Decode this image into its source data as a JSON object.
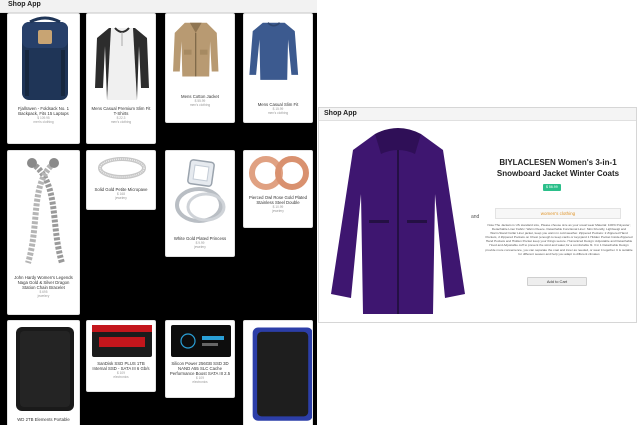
{
  "left_window": {
    "app_title": "Shop App",
    "products": [
      {
        "name": "Fjallraven - Foldsack No. 1 Backpack, Fits 15 Laptops",
        "price": "$ 109.95",
        "category": "men's clothing",
        "icon": "backpack"
      },
      {
        "name": "Mens Casual Premium Slim Fit T-Shirts",
        "price": "$ 22.3",
        "category": "men's clothing",
        "icon": "raglan-shirt"
      },
      {
        "name": "Mens Cotton Jacket",
        "price": "$ 55.99",
        "category": "men's clothing",
        "icon": "cotton-jacket"
      },
      {
        "name": "Mens Casual Slim Fit",
        "price": "$ 15.99",
        "category": "men's clothing",
        "icon": "long-sleeve-shirt"
      },
      {
        "name": "John Hardy Women's Legends Naga Gold & Silver Dragon Station Chain Bracelet",
        "price": "$ 695",
        "category": "jewelery",
        "icon": "chain-bracelet"
      },
      {
        "name": "Solid Gold Petite Micropave",
        "price": "$ 168",
        "category": "jewelery",
        "icon": "silver-ring"
      },
      {
        "name": "White Gold Plated Princess",
        "price": "$ 9.99",
        "category": "jewelery",
        "icon": "diamond-ring"
      },
      {
        "name": "Pierced Owl Rose Gold Plated Stainless Steel Double",
        "price": "$ 10.99",
        "category": "jewelery",
        "icon": "rose-gold-plugs"
      },
      {
        "name": "WD 2TB Elements Portable",
        "price": "",
        "category": "",
        "icon": "black-hard-drive"
      },
      {
        "name": "SanDisk SSD PLUS 1TB Internal SSD - SATA III 6 Gb/s",
        "price": "$ 109",
        "category": "electronics",
        "icon": "sandisk-ssd"
      },
      {
        "name": "Silicon Power 256GB SSD 3D NAND A55 SLC Cache Performance Boost SATA III 2.5",
        "price": "$ 109",
        "category": "electronics",
        "icon": "silicon-power-ssd"
      },
      {
        "name": "",
        "price": "",
        "category": "",
        "icon": "blue-hard-drive"
      }
    ]
  },
  "right_window": {
    "app_title": "Shop App",
    "and_tag": "and",
    "product": {
      "title": "BIYLACLESEN Women's 3-in-1 Snowboard Jacket Winter Coats",
      "price": "$ 56.99",
      "category": "women's clothing",
      "description": "Note:The Jackets is US standard size, Please choose size as your usual wear Material: 100% Polyester; Detachable Liner Fabric: Warm Fleece. Detachable Functional Liner: Skin Friendly, Lightweigt and Warm.Stand Collar Liner jacket, keep you warm in cold weather. Zippered Pockets: 2 Zippered Hand Pockets, 2 Zippered Pockets on Chest (enough to keep cards or keys)and 1 Hidden Pocket Inside.Zippered Hand Pockets and Hidden Pocket keep your things secure. Humanized Design: Adjustable and Detachable Hood and Adjustable cuff to prevent the wind and water,for a comfortable fit. 3 in 1 Detachable Design provide more convenience, you can separate the coat and inner as needed, or wear it together. It is suitable for different season and help you adapt to different climates",
      "button_label": "Add to Cart",
      "icon": "purple-winter-jacket"
    }
  },
  "colors": {
    "price_badge": "#2bbf8a",
    "category_text": "#e0952a",
    "jacket": "#3e1670"
  }
}
